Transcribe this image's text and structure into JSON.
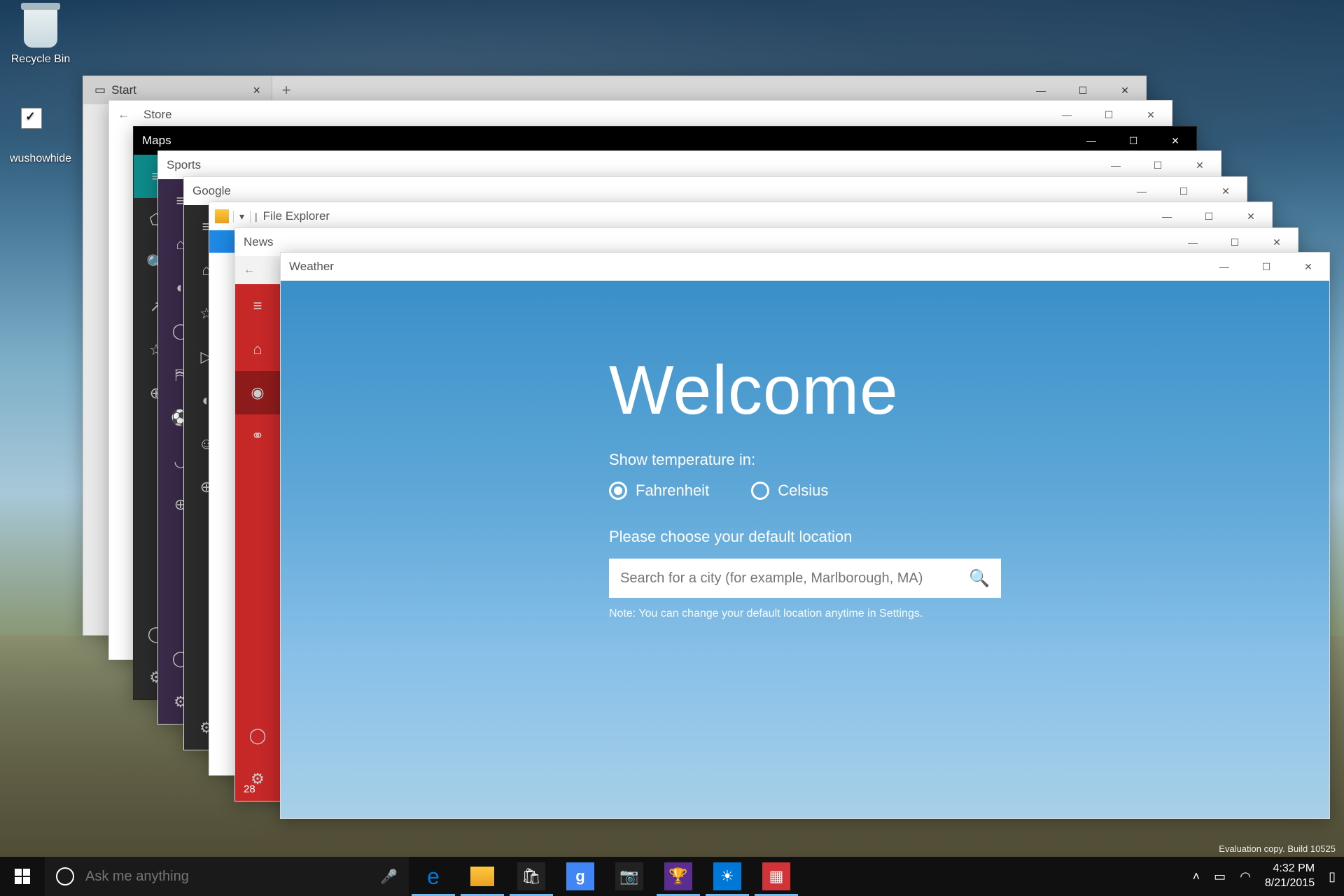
{
  "desktop_icons": {
    "recycle": "Recycle Bin",
    "wushowhide": "wushowhide"
  },
  "windows": {
    "edge": {
      "title": "Start"
    },
    "store": {
      "title": "Store"
    },
    "maps": {
      "title": "Maps"
    },
    "sports": {
      "title": "Sports"
    },
    "google": {
      "title": "Google"
    },
    "explorer": {
      "title": "File Explorer"
    },
    "news": {
      "title": "News"
    },
    "weather": {
      "title": "Weather"
    }
  },
  "weather": {
    "heading": "Welcome",
    "temp_prompt": "Show temperature in:",
    "fahrenheit": "Fahrenheit",
    "celsius": "Celsius",
    "location_prompt": "Please choose your default location",
    "search_placeholder": "Search for a city (for example, Marlborough, MA)",
    "note": "Note: You can change your default location anytime in Settings."
  },
  "taskbar": {
    "search_placeholder": "Ask me anything",
    "time": "4:32 PM",
    "date": "8/21/2015"
  },
  "eval": {
    "line1": "Evaluation copy. Build 10525",
    "line2": ""
  },
  "partial_text": {
    "news_number": "28"
  },
  "colors": {
    "weather_bg": "#4a9bd4",
    "taskbar": "#101010",
    "edge_blue": "#0078d7",
    "google_red": "#DB4437",
    "google_blue": "#4285F4",
    "news_red": "#c62828",
    "store_green": "#0f7b0f"
  }
}
